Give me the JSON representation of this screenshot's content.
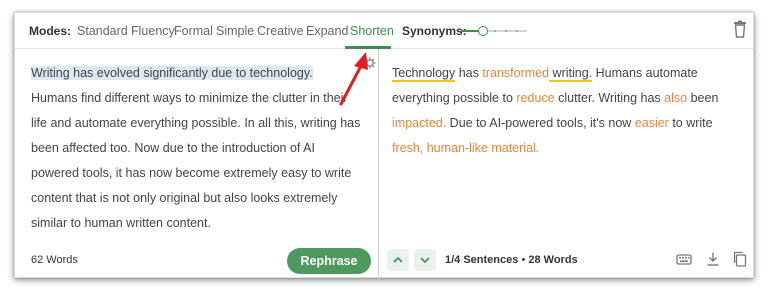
{
  "modes": {
    "label": "Modes:",
    "items": [
      "Standard",
      "Fluency",
      "Formal",
      "Simple",
      "Creative",
      "Expand",
      "Shorten"
    ],
    "active": "Shorten"
  },
  "synonyms": {
    "label": "Synonyms:",
    "level": 0.3
  },
  "input": {
    "sentence_highlighted": "Writing has evolved significantly due to technology.",
    "rest": " Humans find different ways to minimize the clutter in their life and automate everything possible. In all this, writing has been affected too. Now due to the introduction of AI powered tools, it has now become extremely easy to write content that is not only original but also looks extremely similar to human written content.",
    "word_count": "62 Words"
  },
  "rephrase_button": "Rephrase",
  "output": {
    "segments": [
      {
        "text": "Technology",
        "style": "underline"
      },
      {
        "text": " has ",
        "style": "normal"
      },
      {
        "text": "transformed",
        "style": "changed"
      },
      {
        "text": " writing.",
        "style": "underline"
      },
      {
        "text": " Humans automate everything possible to ",
        "style": "normal"
      },
      {
        "text": "reduce",
        "style": "changed"
      },
      {
        "text": " clutter. Writing has ",
        "style": "normal"
      },
      {
        "text": "also",
        "style": "changed"
      },
      {
        "text": " been ",
        "style": "normal"
      },
      {
        "text": "impacted.",
        "style": "changed"
      },
      {
        "text": " Due to AI-powered tools, it's now ",
        "style": "normal"
      },
      {
        "text": "easier",
        "style": "changed"
      },
      {
        "text": " to write ",
        "style": "normal"
      },
      {
        "text": "fresh, human-like material.",
        "style": "changed"
      }
    ],
    "sentence_count": "1/4 Sentences",
    "separator": "•",
    "word_count": "28 Words"
  },
  "colors": {
    "accent_green": "#3d8d52",
    "changed_orange": "#e8843a",
    "highlight_blue": "#dbe9f6",
    "arrow_red": "#e02020"
  }
}
